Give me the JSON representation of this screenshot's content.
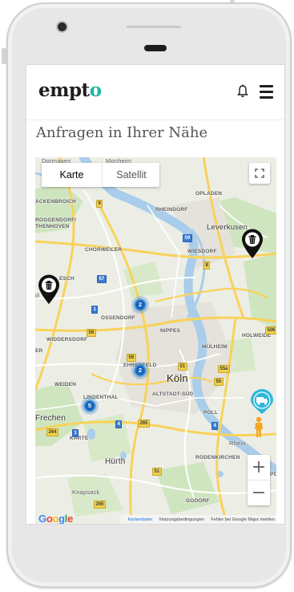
{
  "app": {
    "logo_prefix": "empt",
    "logo_suffix": "o",
    "heading": "Anfragen in Ihrer Nähe"
  },
  "header": {
    "bell_icon": "bell-icon",
    "menu_icon": "hamburger-menu-icon"
  },
  "map": {
    "type_buttons": {
      "map": "Karte",
      "satellite": "Satellit"
    },
    "fullscreen_icon": "fullscreen-icon",
    "zoom_in": "+",
    "zoom_out": "−",
    "google": "Google",
    "footer_links": {
      "map_data": "Kartendaten",
      "terms": "Nutzungsbedingungen",
      "report": "Fehler bei Google Maps melden"
    },
    "places": {
      "dormagen": "Dormagen",
      "monheim": "Monheim",
      "opladen": "OPLADEN",
      "rheindorf": "RHEINDORF",
      "leverkusen": "Leverkusen",
      "esch": "ESCH",
      "ackenbroich": "ACKENBROICH",
      "roggendorf": "ROGGENDORF/",
      "thenhoven": "THENHOVEN",
      "chorweiler": "CHORWEILER",
      "wiesdorf": "WIESDORF",
      "ossendorf": "OSSENDORF",
      "nippes": "NIPPES",
      "widdersdorf": "WIDDERSDORF",
      "ehrenfeld": "EHRENFELD",
      "mulheim": "MÜLHEIM",
      "holweide": "HOLWEIDE",
      "koln": "Köln",
      "altstadt": "ALTSTADT-SÜD",
      "weiden": "WEIDEN",
      "lindenthal": "LINDENTHAL",
      "poll": "POLL",
      "frechen": "Frechen",
      "karte": "KARTE",
      "rhein": "Rhein",
      "hurth": "Hürth",
      "rodenkirchen": "RODENKIRCHEN",
      "knapsack": "Knapsack",
      "godorf": "GODORF",
      "er": "ER",
      "po": "PO",
      "ill": "ill",
      "roads": [
        "9",
        "59",
        "8",
        "57",
        "1",
        "59",
        "59",
        "51",
        "55a",
        "55",
        "506",
        "4",
        "265",
        "1",
        "264",
        "4",
        "51",
        "265"
      ]
    },
    "clusters": [
      {
        "count": "2"
      },
      {
        "count": "2"
      },
      {
        "count": "5"
      }
    ],
    "pins": [
      {
        "icon": "trash-bin-icon",
        "color": "#111111"
      },
      {
        "icon": "trash-bin-icon",
        "color": "#111111"
      },
      {
        "icon": "truck-icon",
        "color": "#2fb7d8"
      }
    ],
    "colors": {
      "accent": "#1fb5a4",
      "water": "#a9cdea",
      "park": "#c8e2b8",
      "highway": "#f8d25a",
      "cluster": "#1976d2"
    }
  }
}
